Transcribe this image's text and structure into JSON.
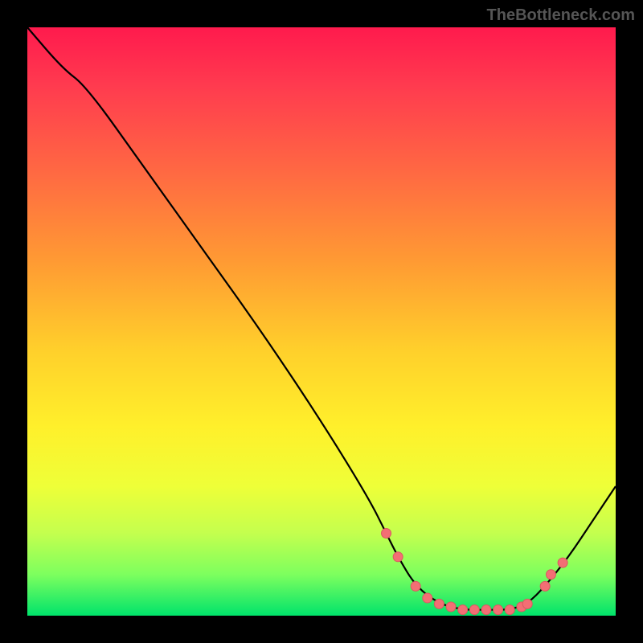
{
  "attribution": "TheBottleneck.com",
  "chart_data": {
    "type": "line",
    "title": "",
    "xlabel": "",
    "ylabel": "",
    "xlim": [
      0,
      100
    ],
    "ylim": [
      0,
      100
    ],
    "curve": {
      "name": "bottleneck-curve",
      "points": [
        {
          "x": 0,
          "y": 100
        },
        {
          "x": 6,
          "y": 93
        },
        {
          "x": 10,
          "y": 90
        },
        {
          "x": 20,
          "y": 76
        },
        {
          "x": 30,
          "y": 62
        },
        {
          "x": 40,
          "y": 48
        },
        {
          "x": 50,
          "y": 33
        },
        {
          "x": 58,
          "y": 20
        },
        {
          "x": 61,
          "y": 14
        },
        {
          "x": 63,
          "y": 10
        },
        {
          "x": 66,
          "y": 5
        },
        {
          "x": 70,
          "y": 2
        },
        {
          "x": 74,
          "y": 1
        },
        {
          "x": 78,
          "y": 1
        },
        {
          "x": 82,
          "y": 1
        },
        {
          "x": 85,
          "y": 2
        },
        {
          "x": 88,
          "y": 5
        },
        {
          "x": 92,
          "y": 10
        },
        {
          "x": 96,
          "y": 16
        },
        {
          "x": 100,
          "y": 22
        }
      ]
    },
    "markers": [
      {
        "x": 61,
        "y": 14
      },
      {
        "x": 63,
        "y": 10
      },
      {
        "x": 66,
        "y": 5
      },
      {
        "x": 68,
        "y": 3
      },
      {
        "x": 70,
        "y": 2
      },
      {
        "x": 72,
        "y": 1.5
      },
      {
        "x": 74,
        "y": 1
      },
      {
        "x": 76,
        "y": 1
      },
      {
        "x": 78,
        "y": 1
      },
      {
        "x": 80,
        "y": 1
      },
      {
        "x": 82,
        "y": 1
      },
      {
        "x": 84,
        "y": 1.5
      },
      {
        "x": 85,
        "y": 2
      },
      {
        "x": 88,
        "y": 5
      },
      {
        "x": 89,
        "y": 7
      },
      {
        "x": 91,
        "y": 9
      }
    ],
    "background_gradient": {
      "top": "#ff1a4d",
      "mid_upper": "#ff9b33",
      "mid": "#fff02b",
      "mid_lower": "#c4ff4e",
      "bottom": "#00e36b"
    }
  }
}
